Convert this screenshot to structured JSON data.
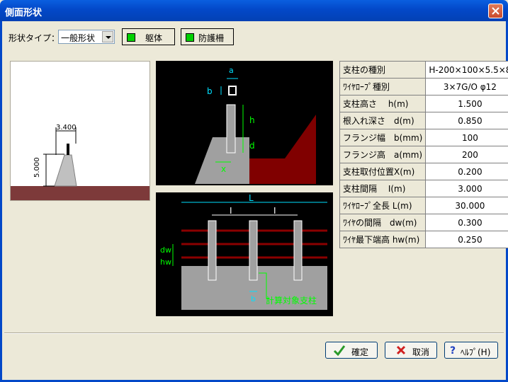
{
  "window": {
    "title": "側面形状"
  },
  "shape_type": {
    "label": "形状タイプ：",
    "value": "一般形状"
  },
  "toggles": [
    {
      "label": "躯体"
    },
    {
      "label": "防護柵"
    }
  ],
  "params": [
    {
      "key": "支柱の種別",
      "value": "H-200×100×5.5×8"
    },
    {
      "key": "ﾜｲﾔﾛｰﾌﾟ種別",
      "value": "3×7G/O φ12"
    },
    {
      "key": "支柱高さ　 h(m)",
      "value": "1.500"
    },
    {
      "key": "根入れ深さ　d(m)",
      "value": "0.850"
    },
    {
      "key": "フランジ幅　b(mm)",
      "value": "100"
    },
    {
      "key": "フランジ高　a(mm)",
      "value": "200"
    },
    {
      "key": "支柱取付位置X(m)",
      "value": "0.200"
    },
    {
      "key": "支柱間隔　 I(m)",
      "value": "3.000"
    },
    {
      "key": "ﾜｲﾔﾛｰﾌﾟ全長 L(m)",
      "value": "30.000"
    },
    {
      "key": "ﾜｲﾔの間隔　dw(m)",
      "value": "0.300"
    },
    {
      "key": "ﾜｲﾔ最下端高 hw(m)",
      "value": "0.250"
    }
  ],
  "preview": {
    "dim_width": "3.400",
    "dim_height": "5.000"
  },
  "cross_section": {
    "label_a": "a",
    "label_b": "b",
    "label_h": "h",
    "label_d": "d",
    "label_x": "x"
  },
  "elevation": {
    "label_L": "L",
    "label_I1": "I",
    "label_I2": "I",
    "label_dw": "dw",
    "label_hw": "hw",
    "label_b": "b",
    "label_target": "計算対象支柱"
  },
  "buttons": {
    "ok": "確定",
    "cancel": "取消",
    "help": "ﾍﾙﾌﾟ(H)"
  },
  "colors": {
    "ground": "#7d3a3a",
    "wire": "#8b0000",
    "dim_cyan": "#00e0ff",
    "dim_green": "#00ff00",
    "concrete": "#a0a0a0"
  }
}
